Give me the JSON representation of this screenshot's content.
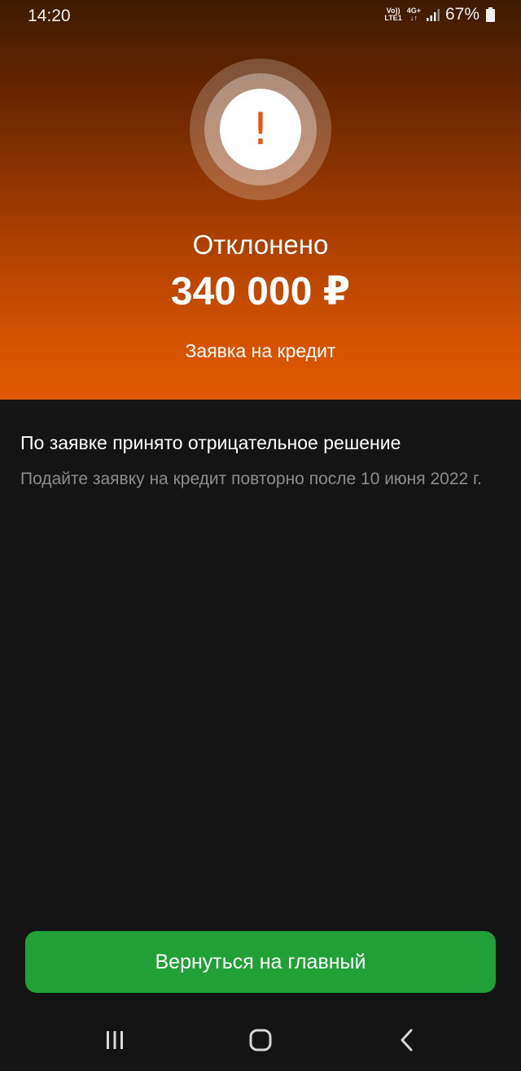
{
  "status_bar": {
    "time": "14:20",
    "volte_line1": "Vo))",
    "volte_line2": "LTE1",
    "network_line1": "4G+",
    "network_line2": "↓↑",
    "battery": "67%"
  },
  "hero": {
    "icon": "exclamation-icon",
    "icon_glyph": "!",
    "status": "Отклонено",
    "amount": "340 000 ₽",
    "subtitle": "Заявка на кредит",
    "gradient_top": "#3e1a00",
    "gradient_bottom": "#e05800"
  },
  "content": {
    "title": "По заявке принято отрицательное решение",
    "description": "Подайте заявку на кредит повторно после 10 июня 2022 г."
  },
  "button": {
    "label": "Вернуться на главный",
    "color": "#21a038"
  },
  "nav": {
    "recents_icon": "recents-icon",
    "home_icon": "home-icon",
    "back_icon": "back-icon"
  }
}
